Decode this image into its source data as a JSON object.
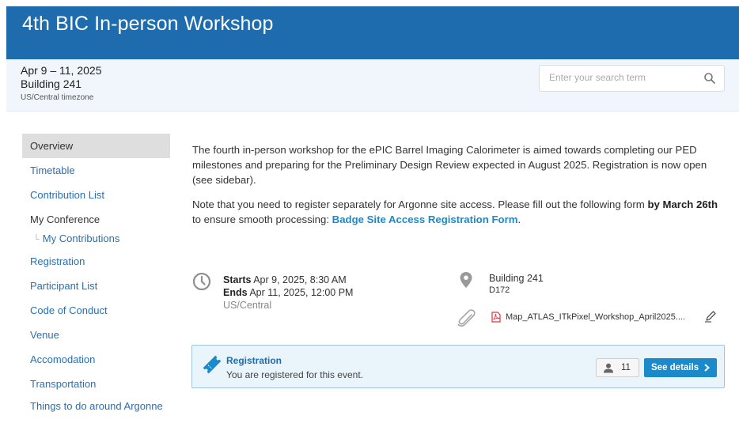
{
  "event": {
    "title": "4th BIC In-person Workshop",
    "dates": "Apr 9 – 11, 2025",
    "room": "Building 241",
    "timezone": "US/Central timezone"
  },
  "search": {
    "placeholder": "Enter your search term"
  },
  "sidebar": {
    "items": [
      {
        "label": "Overview"
      },
      {
        "label": "Timetable"
      },
      {
        "label": "Contribution List"
      },
      {
        "label": "My Conference"
      },
      {
        "label": "My Contributions"
      },
      {
        "label": "Registration"
      },
      {
        "label": "Participant List"
      },
      {
        "label": "Code of Conduct"
      },
      {
        "label": "Venue"
      },
      {
        "label": "Accomodation"
      },
      {
        "label": "Transportation"
      },
      {
        "label": "Things to do around Argonne"
      }
    ]
  },
  "description": {
    "para1": "The fourth in-person workshop for the ePIC Barrel Imaging Calorimeter is aimed towards completing our PED milestones and preparing for the Preliminary Design Review expected in August 2025. Registration is now open (see sidebar).",
    "para2_start": "Note that you need to register separately for Argonne site access. Please fill out the following form ",
    "para2_bold": "by March 26th",
    "para2_mid": " to ensure smooth processing: ",
    "para2_link": "Badge Site Access Registration Form",
    "para2_end": "."
  },
  "schedule": {
    "starts_label": "Starts",
    "starts_value": " Apr 9, 2025, 8:30 AM",
    "ends_label": "Ends",
    "ends_value": " Apr 11, 2025, 12:00 PM",
    "tz": "US/Central"
  },
  "location": {
    "building": "Building 241",
    "room": "D172"
  },
  "attachment": {
    "name": "Map_ATLAS_ITkPixel_Workshop_April2025...."
  },
  "registration": {
    "title": "Registration",
    "subtitle": "You are registered for this event.",
    "count": "11",
    "details_label": "See details"
  },
  "colors": {
    "header": "#1e6cad",
    "link": "#2a6fb0",
    "accent_button": "#1a8acb"
  },
  "icons": [
    "search-icon",
    "clock-icon",
    "location-pin-icon",
    "paperclip-icon",
    "pdf-icon",
    "pencil-icon",
    "ticket-icon",
    "user-icon",
    "chevron-right-icon"
  ]
}
